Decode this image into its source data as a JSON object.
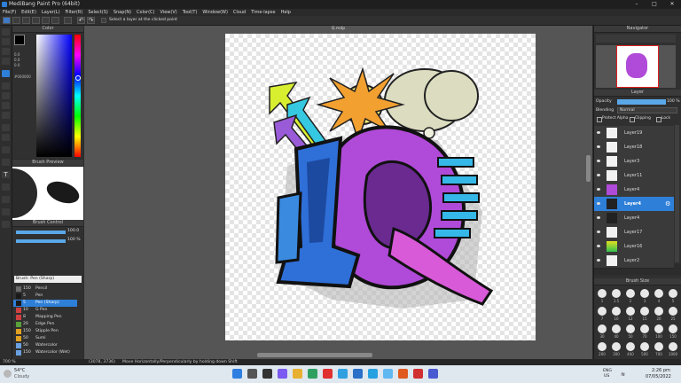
{
  "window": {
    "title": "MediBang Paint Pro (64bit)",
    "minimize": "–",
    "maximize": "□",
    "close": "✕"
  },
  "menu": [
    "File(F)",
    "Edit(E)",
    "Layer(L)",
    "Filter(R)",
    "Select(S)",
    "Snap(N)",
    "Color(C)",
    "View(V)",
    "Tool(T)",
    "Window(W)",
    "Cloud",
    "Time-lapse",
    "Help"
  ],
  "toolbar": {
    "select_layer_label": "Select a layer at the clicked point"
  },
  "color_panel": {
    "title": "Color",
    "hex": "#000000",
    "values": [
      "0.0",
      "0.0",
      "0.0"
    ],
    "accent": "#2e7fd8"
  },
  "brush_preview": {
    "title": "Brush Preview"
  },
  "brush_control": {
    "title": "Brush Control",
    "size_value": "100.0",
    "opacity_value": "100 %"
  },
  "brush_list": {
    "title": "Brush: Pen (Sharp)",
    "items": [
      {
        "size": "150",
        "name": "Pencil",
        "color": "#6b6b6b"
      },
      {
        "size": "5",
        "name": "Pen",
        "color": "#1a1a1a"
      },
      {
        "size": "5",
        "name": "Pen (Sharp)",
        "color": "#1a1a1a",
        "selected": true
      },
      {
        "size": "10",
        "name": "G Pen",
        "color": "#d04040"
      },
      {
        "size": "8",
        "name": "Mapping Pen",
        "color": "#d04040"
      },
      {
        "size": "20",
        "name": "Edge Pen",
        "color": "#5aa03a"
      },
      {
        "size": "150",
        "name": "Stipple Pen",
        "color": "#e0a020"
      },
      {
        "size": "50",
        "name": "Sumi",
        "color": "#e0a020"
      },
      {
        "size": "50",
        "name": "Watercolor",
        "color": "#6aa0e0"
      },
      {
        "size": "150",
        "name": "Watercolor (Wet)",
        "color": "#6aa0e0"
      }
    ]
  },
  "canvas": {
    "tab_title": "Q.mdp"
  },
  "navigator": {
    "title": "Navigator"
  },
  "layer_panel": {
    "title": "Layer",
    "opacity_label": "Opacity",
    "opacity_value": "100 %",
    "blending_label": "Blending",
    "blending_value": "Normal",
    "protect_alpha": "Protect Alpha",
    "clipping": "Clipping",
    "lock": "Lock",
    "layers": [
      {
        "name": "Layer19"
      },
      {
        "name": "Layer18"
      },
      {
        "name": "Layer3"
      },
      {
        "name": "Layer11"
      },
      {
        "name": "Layer4"
      },
      {
        "name": "Layer4",
        "selected": true
      },
      {
        "name": "Layer4"
      },
      {
        "name": "Layer17"
      },
      {
        "name": "Layer16"
      },
      {
        "name": "Layer2"
      }
    ]
  },
  "brush_size": {
    "title": "Brush Size",
    "sizes": [
      "1",
      "1.5",
      "2",
      "3",
      "4",
      "5",
      "7",
      "10",
      "12",
      "15",
      "20",
      "25",
      "30",
      "40",
      "50",
      "70",
      "100",
      "150",
      "200",
      "300",
      "400",
      "500",
      "700",
      "1000"
    ]
  },
  "status": {
    "zoom": "700 %",
    "coords": "(3078, 3736)",
    "hint": "Move Horizontally/Perpendicularly by holding down Shift"
  },
  "taskbar": {
    "weather_temp": "54°C",
    "weather_desc": "Cloudy",
    "lang": "ENG",
    "region": "US",
    "time": "2:26 pm",
    "date": "07/05/2022"
  }
}
